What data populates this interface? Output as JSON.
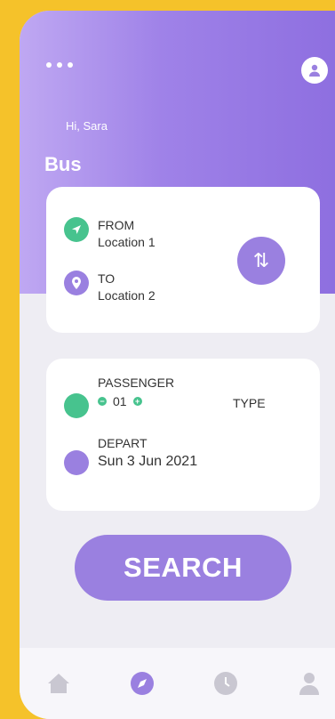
{
  "header": {
    "greeting": "Hi, Sara",
    "title": "Bus"
  },
  "route": {
    "from_label": "FROM",
    "from_value": "Location 1",
    "to_label": "TO",
    "to_value": "Location 2",
    "swap_icon": "⇅"
  },
  "details": {
    "passenger_label": "PASSENGER",
    "passenger_count": "01",
    "type_label": "TYPE",
    "depart_label": "DEPART",
    "depart_value": "Sun 3 Jun 2021"
  },
  "search_label": "SEARCH",
  "colors": {
    "accent": "#9a80e0",
    "green": "#47c38e",
    "background": "#f5c22a"
  },
  "nav": [
    "home-icon",
    "compass-icon",
    "clock-icon",
    "profile-icon"
  ]
}
